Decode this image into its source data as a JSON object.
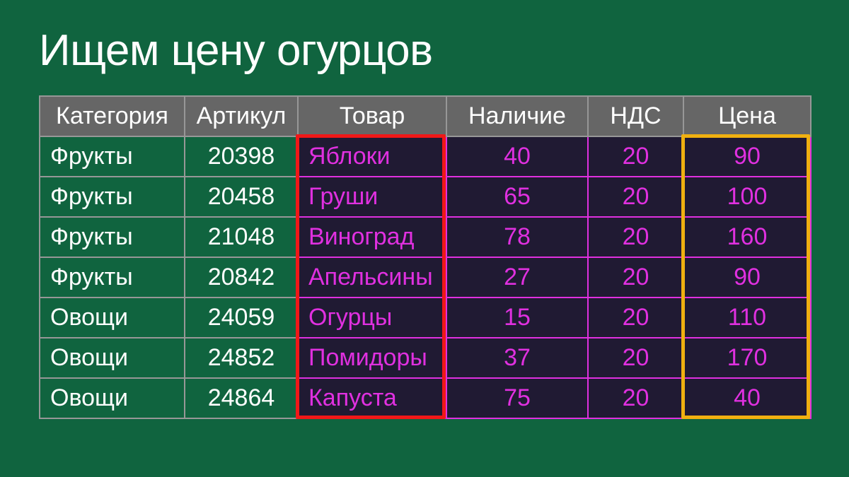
{
  "title": "Ищем цену огурцов",
  "headers": {
    "category": "Категория",
    "sku": "Артикул",
    "product": "Товар",
    "stock": "Наличие",
    "vat": "НДС",
    "price": "Цена"
  },
  "rows": [
    {
      "category": "Фрукты",
      "sku": "20398",
      "product": "Яблоки",
      "stock": "40",
      "vat": "20",
      "price": "90"
    },
    {
      "category": "Фрукты",
      "sku": "20458",
      "product": "Груши",
      "stock": "65",
      "vat": "20",
      "price": "100"
    },
    {
      "category": "Фрукты",
      "sku": "21048",
      "product": "Виноград",
      "stock": "78",
      "vat": "20",
      "price": "160"
    },
    {
      "category": "Фрукты",
      "sku": "20842",
      "product": "Апельсины",
      "stock": "27",
      "vat": "20",
      "price": "90"
    },
    {
      "category": "Овощи",
      "sku": "24059",
      "product": "Огурцы",
      "stock": "15",
      "vat": "20",
      "price": "110"
    },
    {
      "category": "Овощи",
      "sku": "24852",
      "product": "Помидоры",
      "stock": "37",
      "vat": "20",
      "price": "170"
    },
    {
      "category": "Овощи",
      "sku": "24864",
      "product": "Капуста",
      "stock": "75",
      "vat": "20",
      "price": "40"
    }
  ],
  "highlights": {
    "product_column": {
      "color": "#f01818"
    },
    "price_column": {
      "color": "#f0b010"
    }
  },
  "chart_data": {
    "type": "table",
    "columns": [
      "Категория",
      "Артикул",
      "Товар",
      "Наличие",
      "НДС",
      "Цена"
    ],
    "data": [
      [
        "Фрукты",
        20398,
        "Яблоки",
        40,
        20,
        90
      ],
      [
        "Фрукты",
        20458,
        "Груши",
        65,
        20,
        100
      ],
      [
        "Фрукты",
        21048,
        "Виноград",
        78,
        20,
        160
      ],
      [
        "Фрукты",
        20842,
        "Апельсины",
        27,
        20,
        90
      ],
      [
        "Овощи",
        24059,
        "Огурцы",
        15,
        20,
        110
      ],
      [
        "Овощи",
        24852,
        "Помидоры",
        37,
        20,
        170
      ],
      [
        "Овощи",
        24864,
        "Капуста",
        75,
        20,
        40
      ]
    ],
    "title": "Ищем цену огурцов"
  }
}
